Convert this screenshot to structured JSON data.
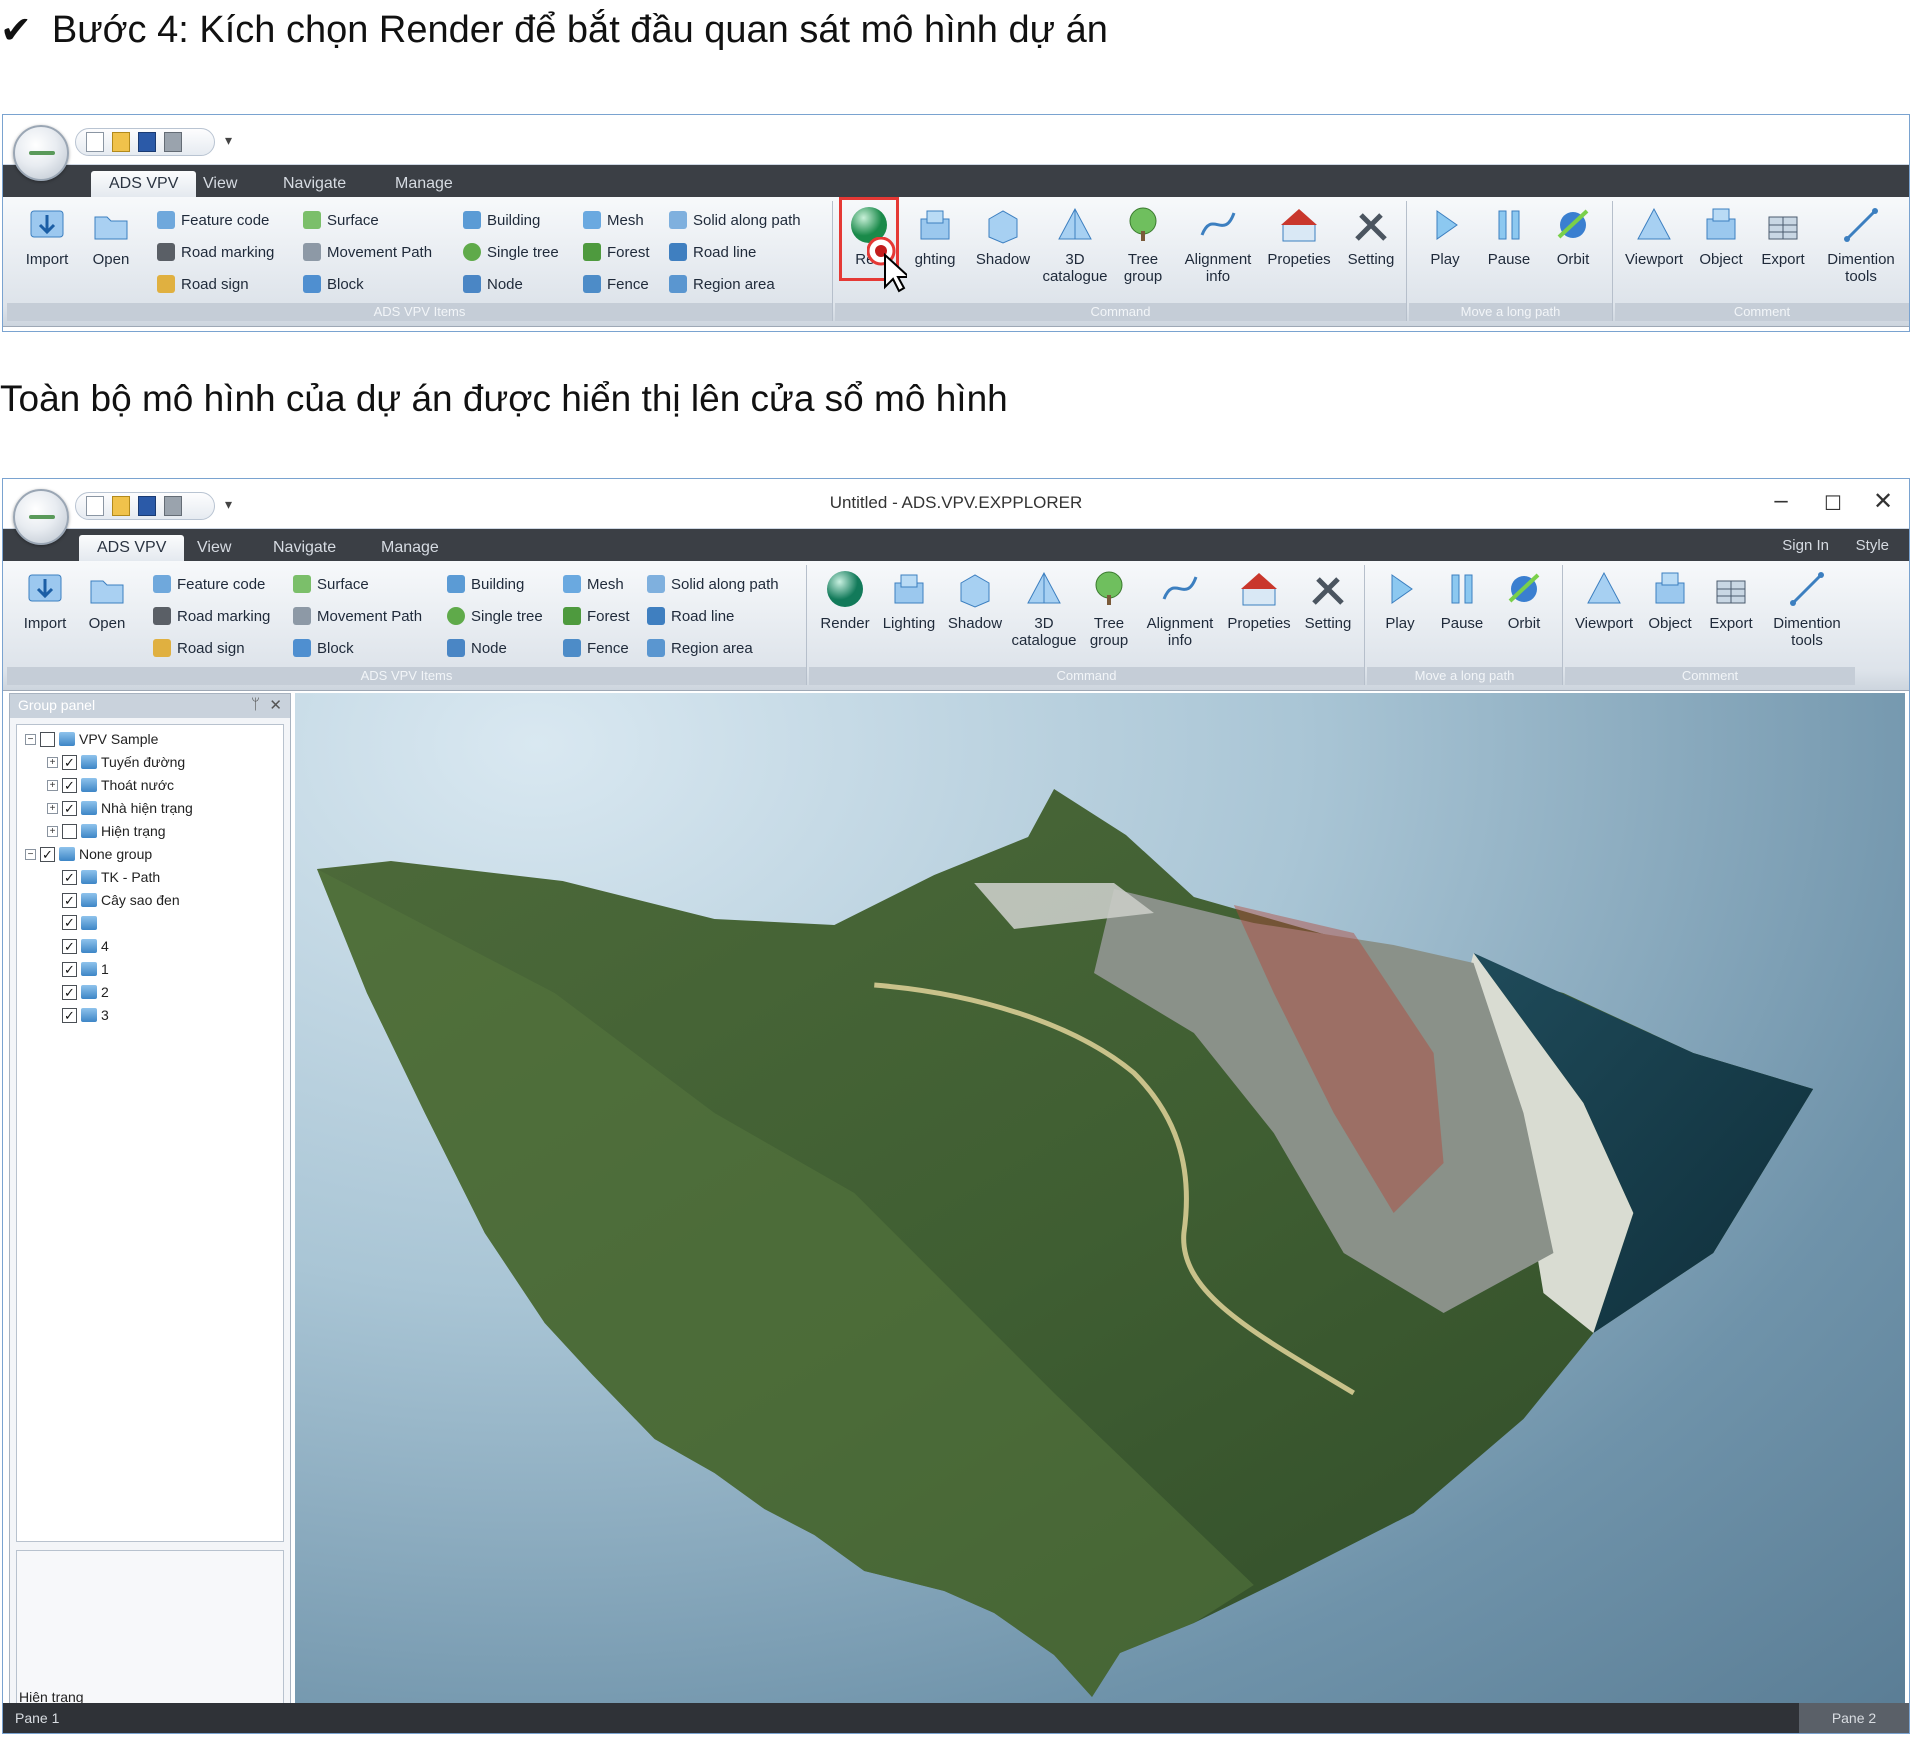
{
  "instructions": {
    "step4": "Bước 4: Kích chọn Render để bắt đầu quan sát mô hình dự án",
    "caption": "Toàn bộ mô hình của dự án được hiển thị lên cửa sổ mô hình"
  },
  "app": {
    "title": "Untitled - ADS.VPV.EXPPLORER",
    "tabs": [
      "ADS VPV",
      "View",
      "Navigate",
      "Manage"
    ],
    "tab_right": {
      "sign_in": "Sign In",
      "style": "Style"
    },
    "groups": {
      "items": {
        "label": "ADS VPV Items",
        "big": [
          "Import",
          "Open"
        ],
        "col1": [
          "Feature code",
          "Road marking",
          "Road sign"
        ],
        "col2": [
          "Surface",
          "Movement Path",
          "Block"
        ],
        "col3": [
          "Building",
          "Single tree",
          "Node"
        ],
        "col4": [
          "Mesh",
          "Forest",
          "Fence"
        ],
        "col5": [
          "Solid along path",
          "Road line",
          "Region area"
        ]
      },
      "command": {
        "label": "Command",
        "buttons": [
          "Render",
          "Lighting",
          "Shadow",
          "3D catalogue",
          "Tree group",
          "Alignment info",
          "Propeties",
          "Setting"
        ],
        "render_truncated": "Ren",
        "lighting_truncated": "ghting"
      },
      "move": {
        "label": "Move a long path",
        "buttons": [
          "Play",
          "Pause",
          "Orbit"
        ]
      },
      "comment": {
        "label": "Comment",
        "buttons": [
          "Viewport",
          "Object",
          "Export",
          "Dimention tools"
        ]
      }
    },
    "panel": {
      "title": "Group panel",
      "tree": [
        {
          "label": "VPV Sample",
          "checked": false
        },
        {
          "label": "Tuyến đường",
          "checked": true
        },
        {
          "label": "Thoát nước",
          "checked": true
        },
        {
          "label": "Nhà hiện trạng",
          "checked": true
        },
        {
          "label": "Hiện trạng",
          "checked": false
        },
        {
          "label": "None group",
          "checked": true
        },
        {
          "label": "TK - Path",
          "checked": true
        },
        {
          "label": "Cây sao đen",
          "checked": true
        },
        {
          "label": "",
          "checked": true
        },
        {
          "label": "4",
          "checked": true
        },
        {
          "label": "1",
          "checked": true
        },
        {
          "label": "2",
          "checked": true
        },
        {
          "label": "3",
          "checked": true
        }
      ],
      "selected_label": "Hiện trạng"
    },
    "status": {
      "left": "Pane 1",
      "right": "Pane 2"
    }
  },
  "colors": {
    "accent_highlight": "#e53935",
    "tab_bar": "#3b3f45",
    "border": "#7aa3d0"
  }
}
